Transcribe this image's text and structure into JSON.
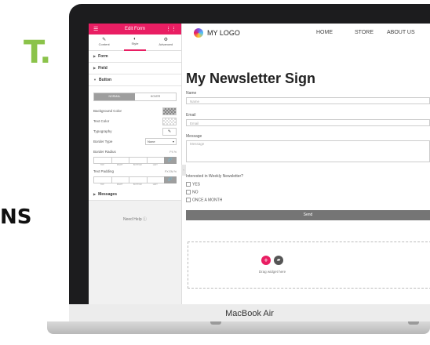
{
  "background": {
    "big_text": "T.",
    "side_text": "NS"
  },
  "device": {
    "label": "MacBook Air"
  },
  "editor": {
    "title": "Edit Form",
    "tabs": [
      {
        "label": "Content",
        "icon": "pencil-icon"
      },
      {
        "label": "Style",
        "icon": "contrast-icon"
      },
      {
        "label": "Advanced",
        "icon": "gear-icon"
      }
    ],
    "sections": {
      "form": "Form",
      "field": "Field",
      "button": "Button",
      "messages": "Messages"
    },
    "state_tabs": {
      "normal": "NORMAL",
      "hover": "HOVER"
    },
    "rows": {
      "background_color": "Background Color",
      "text_color": "Text Color",
      "typography": "Typography",
      "border_type": "Border Type",
      "border_type_value": "None",
      "border_radius": "Border Radius",
      "text_padding": "Text Padding"
    },
    "units": {
      "radius": "PX %",
      "padding": "PX EM %"
    },
    "dim_labels": [
      "TOP",
      "RIGHT",
      "BOTTOM",
      "LEFT"
    ],
    "need_help": "Need Help"
  },
  "site": {
    "logo": "MY LOGO",
    "nav": [
      "HOME",
      "STORE",
      "ABOUT US"
    ],
    "heading": "My Newsletter Sign",
    "fields": [
      {
        "label": "Name",
        "placeholder": "Name"
      },
      {
        "label": "Email",
        "placeholder": "Email"
      },
      {
        "label": "Message",
        "placeholder": "Message"
      }
    ],
    "question": "Interested in Weekly Newsletter?",
    "options": [
      "YES",
      "NO",
      "ONCE A MONTH"
    ],
    "send": "Send",
    "dropzone_text": "Drag widget here"
  },
  "colors": {
    "accent": "#e91e63",
    "brand_green": "#8bc34a"
  }
}
